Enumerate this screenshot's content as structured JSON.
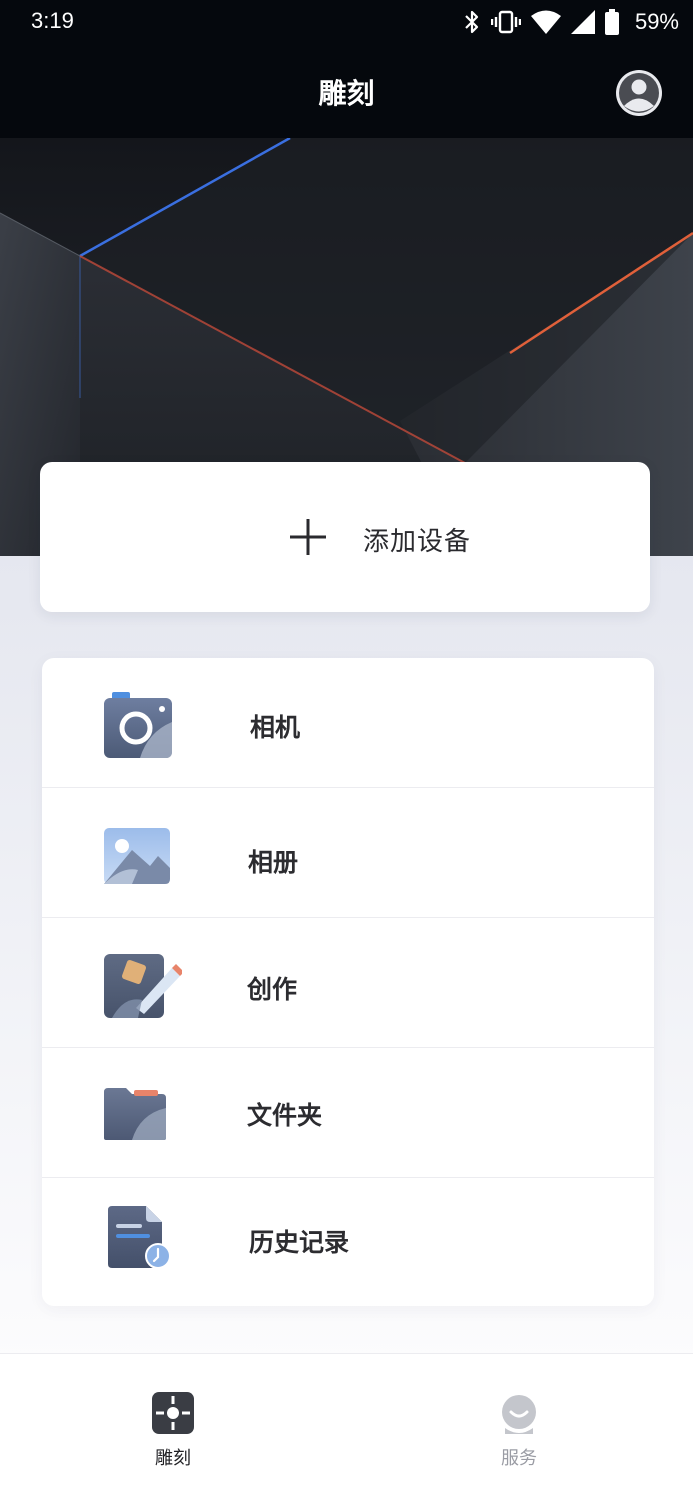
{
  "status_bar": {
    "time": "3:19",
    "battery_percent": "59%",
    "icons": [
      "bluetooth-icon",
      "vibrate-icon",
      "wifi-icon",
      "cell-signal-icon",
      "battery-icon"
    ]
  },
  "header": {
    "title": "雕刻",
    "profile_icon": "user-avatar-icon"
  },
  "add_device": {
    "label": "添加设备",
    "icon": "plus-icon"
  },
  "menu": {
    "items": [
      {
        "label": "相机",
        "icon": "camera-icon"
      },
      {
        "label": "相册",
        "icon": "album-icon"
      },
      {
        "label": "创作",
        "icon": "create-icon"
      },
      {
        "label": "文件夹",
        "icon": "folder-icon"
      },
      {
        "label": "历史记录",
        "icon": "history-icon"
      }
    ]
  },
  "bottom_nav": {
    "tabs": [
      {
        "label": "雕刻",
        "icon": "engrave-icon",
        "active": true
      },
      {
        "label": "服务",
        "icon": "service-icon",
        "active": false
      }
    ]
  },
  "colors": {
    "header_bg": "#05080d",
    "accent_blue": "#3a6fe0",
    "accent_orange": "#e0603a",
    "icon_slate": "#5c6a88"
  }
}
